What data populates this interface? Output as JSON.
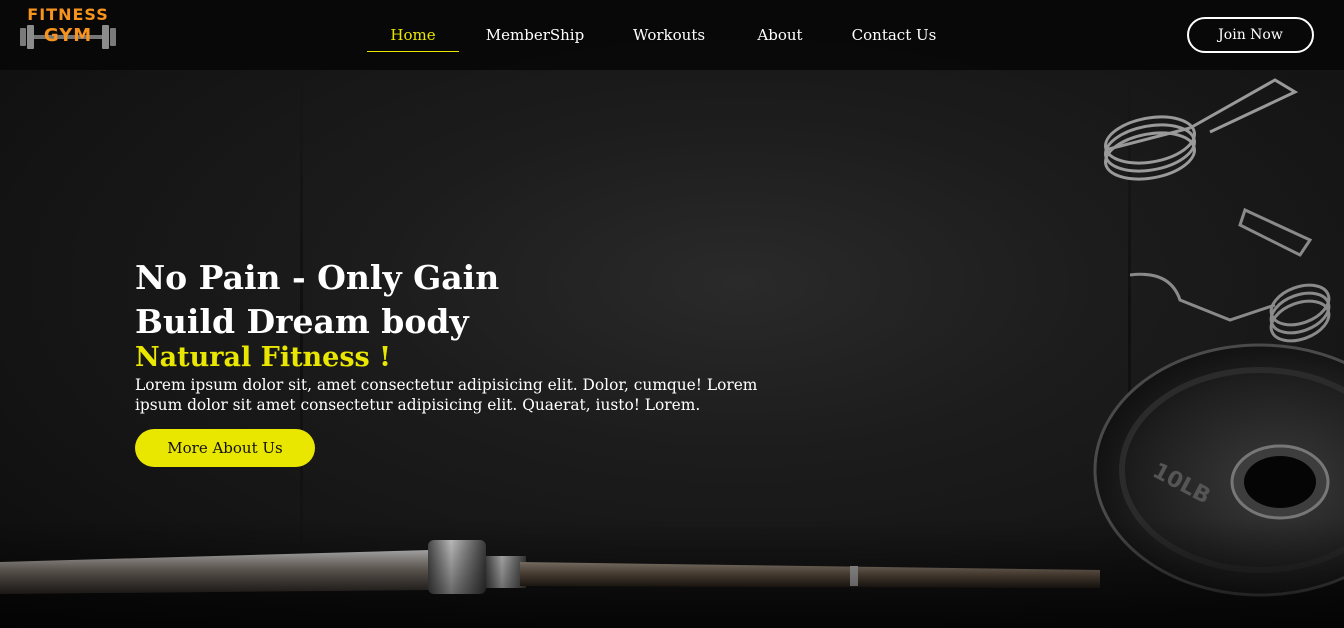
{
  "brand": {
    "logo_top": "FITNESS",
    "logo_bottom": "GYM",
    "logo_color": "#f7941d"
  },
  "nav": {
    "items": [
      {
        "label": "Home",
        "active": true
      },
      {
        "label": "MemberShip",
        "active": false
      },
      {
        "label": "Workouts",
        "active": false
      },
      {
        "label": "About",
        "active": false
      },
      {
        "label": "Contact Us",
        "active": false
      }
    ],
    "join_label": "Join Now"
  },
  "hero": {
    "headline_line1": "No Pain - Only Gain",
    "headline_line2": "Build Dream body",
    "subheadline": "Natural Fitness !",
    "paragraph": "Lorem ipsum dolor sit, amet consectetur adipisicing elit. Dolor, cumque! Lorem ipsum dolor sit amet consectetur adipisicing elit. Quaerat, iusto! Lorem.",
    "cta_label": "More About Us",
    "background_image": "gym-floor-with-barbell-and-weight-plate"
  },
  "colors": {
    "accent": "#e9e600",
    "background": "#141414",
    "text": "#ffffff"
  }
}
